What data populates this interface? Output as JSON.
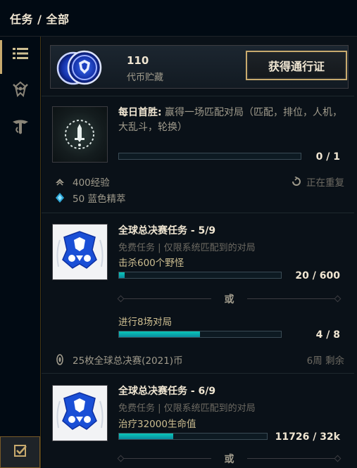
{
  "header": {
    "title": "任务 / 全部"
  },
  "nav": {
    "items": [
      {
        "name": "list-icon",
        "active": true
      },
      {
        "name": "crossed-swords-emblem-icon",
        "active": false
      },
      {
        "name": "tft-logo-icon",
        "active": false
      }
    ],
    "bottom_icon": "checkbox-icon"
  },
  "token_bank": {
    "amount": "110",
    "label": "代币贮藏",
    "button_label": "获得通行证"
  },
  "missions": [
    {
      "title_strong": "每日首胜:",
      "title_rest": " 赢得一场匹配对局（匹配，排位，人机，大乱斗，轮换）",
      "objectives": [
        {
          "label": "",
          "progress_text": "0 / 1",
          "progress": 0.0
        }
      ],
      "rewards": [
        {
          "icon": "xp-chevron-icon",
          "text": "400经验"
        },
        {
          "icon": "blue-essence-icon",
          "text": "50 蓝色精萃"
        }
      ],
      "right_note": "正在重复",
      "right_note_icon": "repeat-icon"
    },
    {
      "title_strong": "全球总决赛任务 - 5/9",
      "subtitle": "免费任务 | 仅限系统匹配到的对局",
      "objectives": [
        {
          "label": "击杀600个野怪",
          "progress_text": "20 / 600",
          "progress": 0.033
        },
        {
          "label": "进行8场对局",
          "progress_text": "4 / 8",
          "progress": 0.5
        }
      ],
      "or_label": "或",
      "rewards": [
        {
          "icon": "worlds-token-icon",
          "text": "25枚全球总决赛(2021)币"
        }
      ],
      "right_note": "6周 剩余"
    },
    {
      "title_strong": "全球总决赛任务 - 6/9",
      "subtitle": "免费任务 | 仅限系统匹配到的对局",
      "objectives": [
        {
          "label": "治疗32000生命值",
          "progress_text": "11726 / 32k",
          "progress": 0.366
        }
      ],
      "or_label": "或"
    }
  ],
  "colors": {
    "gold": "#c8aa6e",
    "teal_fill": "#0ac8b9",
    "background": "#010a13",
    "worlds_blue": "#1a4fd6"
  }
}
